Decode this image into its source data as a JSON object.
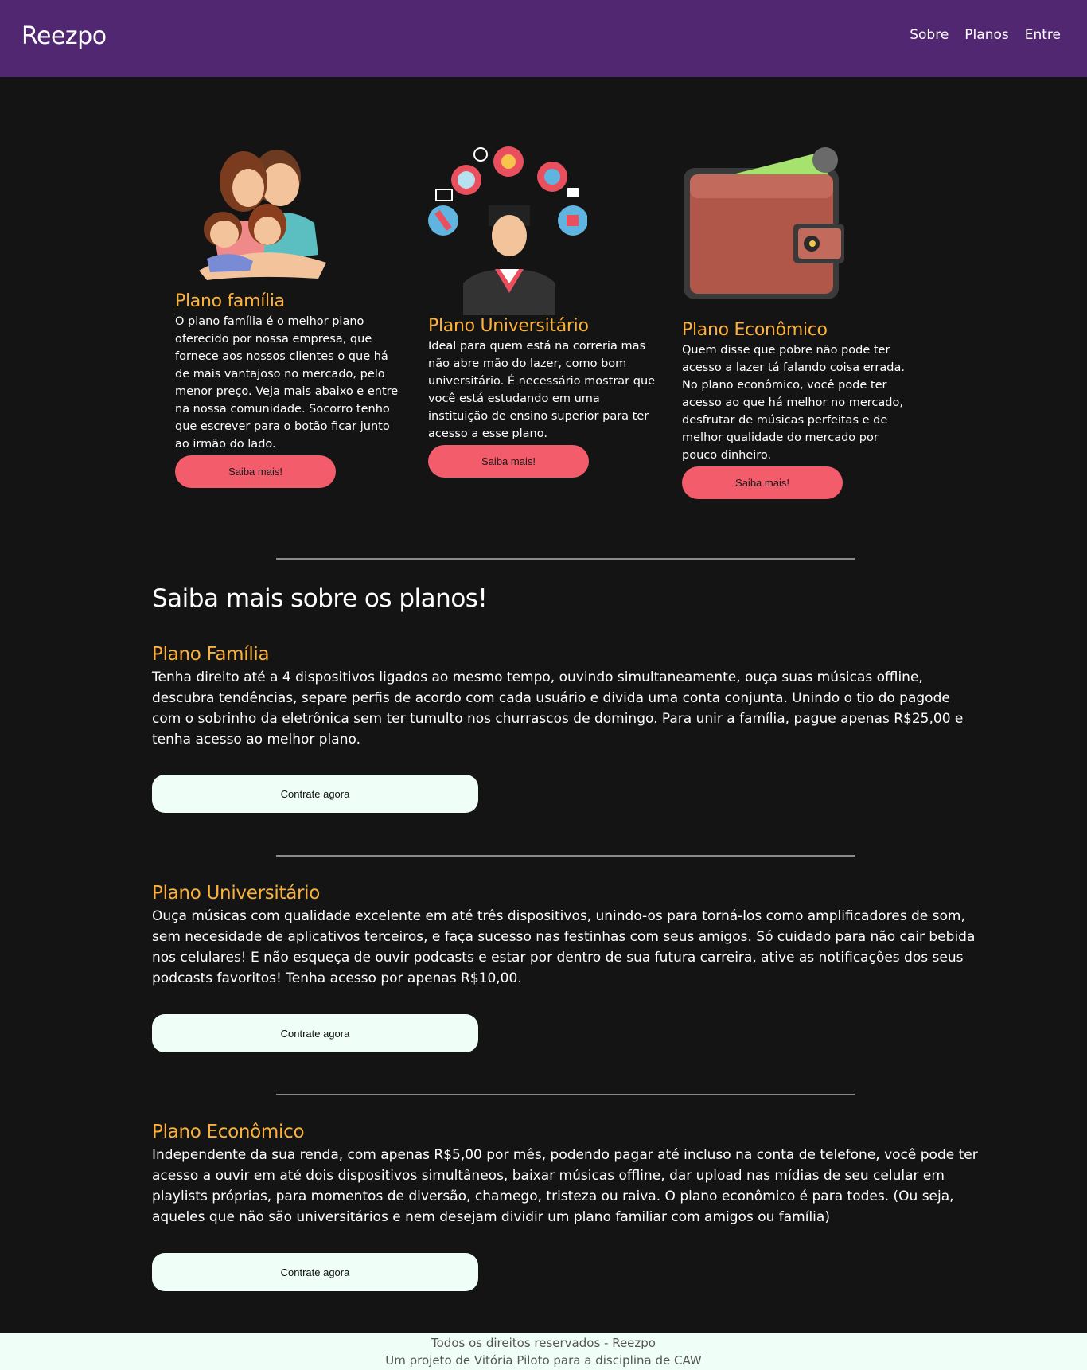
{
  "header": {
    "brand": "Reezpo",
    "nav": [
      "Sobre",
      "Planos",
      "Entre"
    ]
  },
  "cards": [
    {
      "image_icon": "family-illustration",
      "title": "Plano família",
      "text": "O plano família é o melhor plano oferecido por nossa empresa, que fornece aos nossos clientes o que há de mais vantajoso no mercado, pelo menor preço. Veja mais abaixo e entre na nossa comunidade. Socorro tenho que escrever para o botão ficar junto ao irmão do lado.",
      "button": "Saiba mais!"
    },
    {
      "image_icon": "graduate-illustration",
      "title": "Plano Universitário",
      "text": "Ideal para quem está na correria mas não abre mão do lazer, como bom universitário. É necessário mostrar que você está estudando em uma instituição de ensino superior para ter acesso a esse plano.",
      "button": "Saiba mais!"
    },
    {
      "image_icon": "wallet-illustration",
      "title": "Plano Econômico",
      "text": "Quem disse que pobre não pode ter acesso a lazer tá falando coisa errada. No plano econômico, você pode ter acesso ao que há melhor no mercado, desfrutar de músicas perfeitas e de melhor qualidade do mercado por pouco dinheiro.",
      "button": "Saiba mais!"
    }
  ],
  "details": {
    "title": "Saiba mais sobre os planos!",
    "plans": [
      {
        "title": "Plano Família",
        "text": "Tenha direito até a 4 dispositivos ligados ao mesmo tempo, ouvindo simultaneamente, ouça suas músicas offline, descubra tendências, separe perfis de acordo com cada usuário e divida uma conta conjunta. Unindo o tio do pagode com o sobrinho da eletrônica sem ter tumulto nos churrascos de domingo. Para unir a família, pague apenas R$25,00 e tenha acesso ao melhor plano.",
        "button": "Contrate agora"
      },
      {
        "title": "Plano Universitário",
        "text": "Ouça músicas com qualidade excelente em até três dispositivos, unindo-os para torná-los como amplificadores de som, sem necesidade de aplicativos terceiros, e faça sucesso nas festinhas com seus amigos. Só cuidado para não cair bebida nos celulares! E não esqueça de ouvir podcasts e estar por dentro de sua futura carreira, ative as notificações dos seus podcasts favoritos! Tenha acesso por apenas R$10,00.",
        "button": "Contrate agora"
      },
      {
        "title": "Plano Econômico",
        "text": "Independente da sua renda, com apenas R$5,00 por mês, podendo pagar até incluso na conta de telefone, você pode ter acesso a ouvir em até dois dispositivos simultâneos, baixar músicas offline, dar upload nas mídias de seu celular em playlists próprias, para momentos de diversão, chamego, tristeza ou raiva. O plano econômico é para todes. (Ou seja, aqueles que não são universitários e nem desejam dividir um plano familiar com amigos ou família)",
        "button": "Contrate agora"
      }
    ]
  },
  "footer": {
    "line1": "Todos os direitos reservados - Reezpo",
    "line2": "Um projeto de Vitória Piloto para a disciplina de CAW"
  },
  "colors": {
    "header_bg": "#522772",
    "page_bg": "#141414",
    "accent_title": "#fbb13b",
    "button_red": "#f25c6b",
    "button_light": "#effff8"
  }
}
